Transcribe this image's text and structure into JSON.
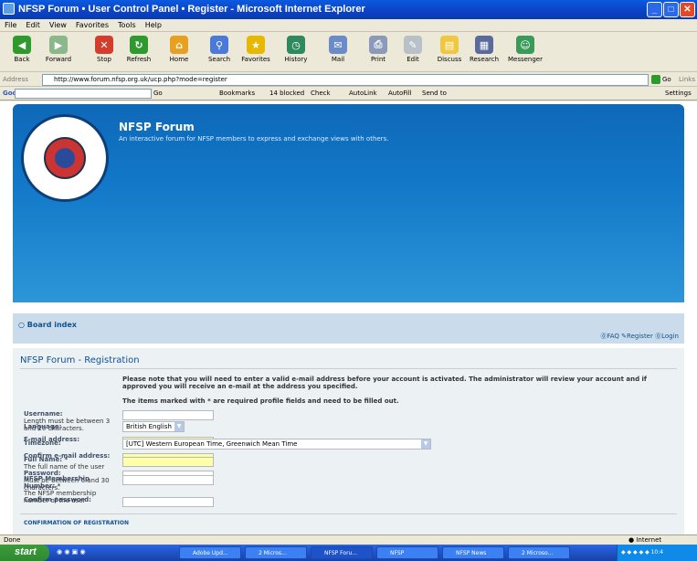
{
  "window": {
    "title": "NFSP Forum • User Control Panel • Register - Microsoft Internet Explorer",
    "min": "_",
    "max": "□",
    "close": "✕"
  },
  "menu": [
    "File",
    "Edit",
    "View",
    "Favorites",
    "Tools",
    "Help"
  ],
  "toolbar": [
    {
      "label": "Back",
      "icon": "back-icon",
      "color": "#2e9a2e",
      "glyph": "◀"
    },
    {
      "label": "Forward",
      "icon": "forward-icon",
      "color": "#8ab88a",
      "glyph": "▶"
    },
    {
      "label": "Stop",
      "icon": "stop-icon",
      "color": "#d43c2c",
      "glyph": "✕"
    },
    {
      "label": "Refresh",
      "icon": "refresh-icon",
      "color": "#2e9a2e",
      "glyph": "↻"
    },
    {
      "label": "Home",
      "icon": "home-icon",
      "color": "#e8a020",
      "glyph": "⌂"
    },
    {
      "label": "Search",
      "icon": "search-icon",
      "color": "#4a7ad8",
      "glyph": "⚲"
    },
    {
      "label": "Favorites",
      "icon": "favorites-icon",
      "color": "#e8b800",
      "glyph": "★"
    },
    {
      "label": "History",
      "icon": "history-icon",
      "color": "#2e8a5e",
      "glyph": "◷"
    },
    {
      "label": "Mail",
      "icon": "mail-icon",
      "color": "#6a8ac8",
      "glyph": "✉"
    },
    {
      "label": "Print",
      "icon": "print-icon",
      "color": "#8a9ab8",
      "glyph": "⎙"
    },
    {
      "label": "Edit",
      "icon": "edit-icon",
      "color": "#b8c0c8",
      "glyph": "✎"
    },
    {
      "label": "Discuss",
      "icon": "discuss-icon",
      "color": "#f0c840",
      "glyph": "▤"
    },
    {
      "label": "Research",
      "icon": "research-icon",
      "color": "#5a6a9a",
      "glyph": "▦"
    },
    {
      "label": "Messenger",
      "icon": "messenger-icon",
      "color": "#3a9a5a",
      "glyph": "☺"
    }
  ],
  "address": {
    "label": "Address",
    "url": "http://www.forum.nfsp.org.uk/ucp.php?mode=register",
    "go": "Go",
    "links": "Links"
  },
  "google": {
    "logo": "Google G-",
    "go": "Go",
    "bookmarks": "Bookmarks",
    "blocked": "14 blocked",
    "check": "Check",
    "autolink": "AutoLink",
    "autofill": "AutoFill",
    "sendto": "Send to",
    "settings": "Settings"
  },
  "forum": {
    "name": "NFSP Forum",
    "description": "An interactive forum for NFSP members to express and exchange views with others.",
    "board_index": "Board index",
    "faq": "FAQ",
    "register": "Register",
    "login": "Login"
  },
  "registration": {
    "title": "NFSP Forum - Registration",
    "note": "Please note that you will need to enter a valid e-mail address before your account is activated. The administrator will review your account and if approved you will receive an e-mail at the address you specified.",
    "note2": "The items marked with * are required profile fields and need to be filled out.",
    "username_label": "Username:",
    "username_help": "Length must be between 3 and 20 characters.",
    "email_label": "E-mail address:",
    "confirm_email_label": "Confirm e-mail address:",
    "password_label": "Password:",
    "password_help": "Must be between 6 and 30 characters.",
    "confirm_password_label": "Confirm password:",
    "language_label": "Language:",
    "language_value": "British English",
    "timezone_label": "Timezone:",
    "timezone_value": "[UTC] Western European Time, Greenwich Mean Time",
    "fullname_label": "Full Name: *",
    "fullname_help": "The full name of the user",
    "membership_label": "NFSP Membership Number: *",
    "membership_help": "The NFSP membership number of the user",
    "confirmation_header": "CONFIRMATION OF REGISTRATION"
  },
  "status": {
    "left": "Done",
    "right": "Internet"
  },
  "taskbar": {
    "start": "start",
    "tasks": [
      "Adobe Upd...",
      "2 Micros...",
      "NFSP Foru...",
      "NFSP",
      "NFSP News",
      "2 Microso..."
    ],
    "clock": "10:4"
  }
}
